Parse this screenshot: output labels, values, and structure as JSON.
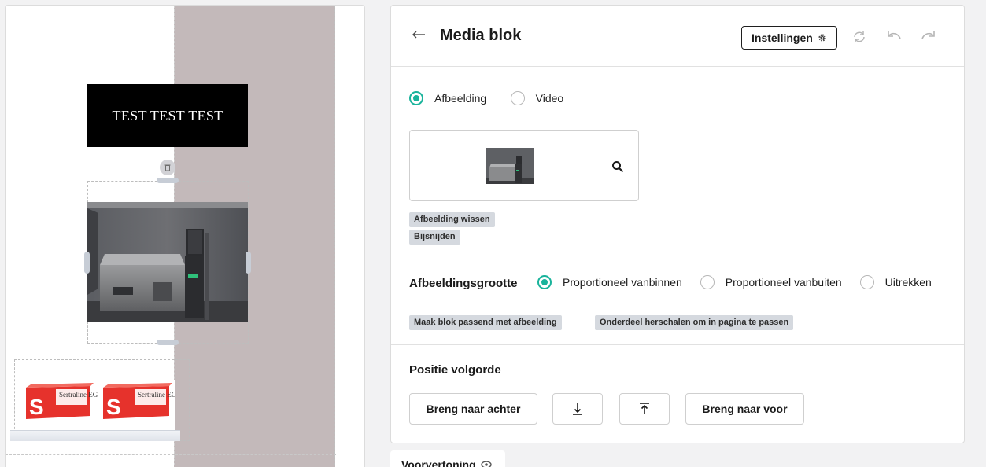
{
  "canvas": {
    "text_block": "TEST TEST TEST",
    "pack_brand": "Sertraline EG",
    "pack_letter": "S"
  },
  "panel": {
    "title": "Media blok",
    "settings_button": "Instellingen",
    "media_type": {
      "options": [
        "Afbeelding",
        "Video"
      ],
      "selected": "Afbeelding"
    },
    "image_actions": [
      "Afbeelding wissen",
      "Bijsnijden"
    ],
    "image_size": {
      "label": "Afbeeldingsgrootte",
      "options": [
        "Proportioneel vanbinnen",
        "Proportioneel vanbuiten",
        "Uitrekken"
      ],
      "selected": "Proportioneel vanbinnen"
    },
    "fit_actions": [
      "Maak blok passend met afbeelding",
      "Onderdeel herschalen om in pagina te passen"
    ],
    "position": {
      "label": "Positie volgorde",
      "send_back": "Breng naar achter",
      "bring_front": "Breng naar voor"
    }
  },
  "preview_tab": "Voorvertoning",
  "icons": {
    "back": "arrow-left-icon",
    "settings": "gear-icon",
    "sync": "sync-icon",
    "undo": "undo-icon",
    "redo": "redo-icon",
    "search": "search-icon",
    "delete": "trash-icon",
    "move_down": "move-down-icon",
    "move_up": "move-up-icon",
    "preview": "eye-icon"
  },
  "colors": {
    "accent": "#19b39b",
    "canvas_background": "#c3b9ba",
    "chip": "#d5d9df"
  }
}
